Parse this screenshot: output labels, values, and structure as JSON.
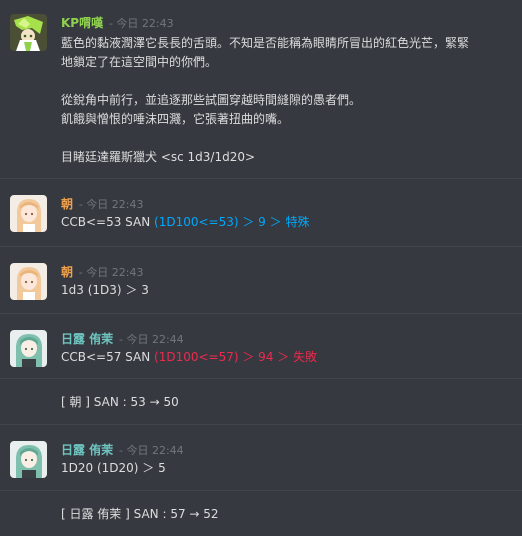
{
  "messages": [
    {
      "author": "KP喟嘆",
      "author_color": "#8fd14f",
      "time": "- 今日 22:43",
      "lines": [
        "藍色的黏液潤澤它長長的舌頭。不知是否能稱為眼睛所冒出的紅色光芒，緊緊",
        "地鎖定了在這空間中的你們。",
        "從銳角中前行，並追逐那些試圖穿越時間縫隙的愚者們。",
        "飢餓與憎恨的唾沫四濺，它張著扭曲的嘴。",
        "目睹廷達羅斯獵犬 <sc 1d3/1d20>"
      ]
    },
    {
      "author": "朝",
      "author_color": "#f0a04b",
      "time": "- 今日 22:43",
      "plain": "CCB<=53 SAN ",
      "highlight": "(1D100<=53) ＞ 9 ＞ 特殊",
      "highlight_color": "#00a8fc"
    },
    {
      "author": "朝",
      "author_color": "#f0a04b",
      "time": "- 今日 22:43",
      "text": "1d3 (1D3) ＞ 3"
    },
    {
      "author": "日露 侑茉",
      "author_color": "#6ec4c0",
      "time": "- 今日 22:44",
      "plain": "CCB<=57 SAN ",
      "highlight": "(1D100<=57) ＞ 94 ＞ 失敗",
      "highlight_color": "#ed2a4e"
    },
    {
      "system": "[ 朝 ] SAN : 53 → 50"
    },
    {
      "author": "日露 侑茉",
      "author_color": "#6ec4c0",
      "time": "- 今日 22:44",
      "text": "1D20 (1D20) ＞ 5"
    },
    {
      "system": "[ 日露 侑茉 ] SAN : 57 → 52"
    }
  ]
}
